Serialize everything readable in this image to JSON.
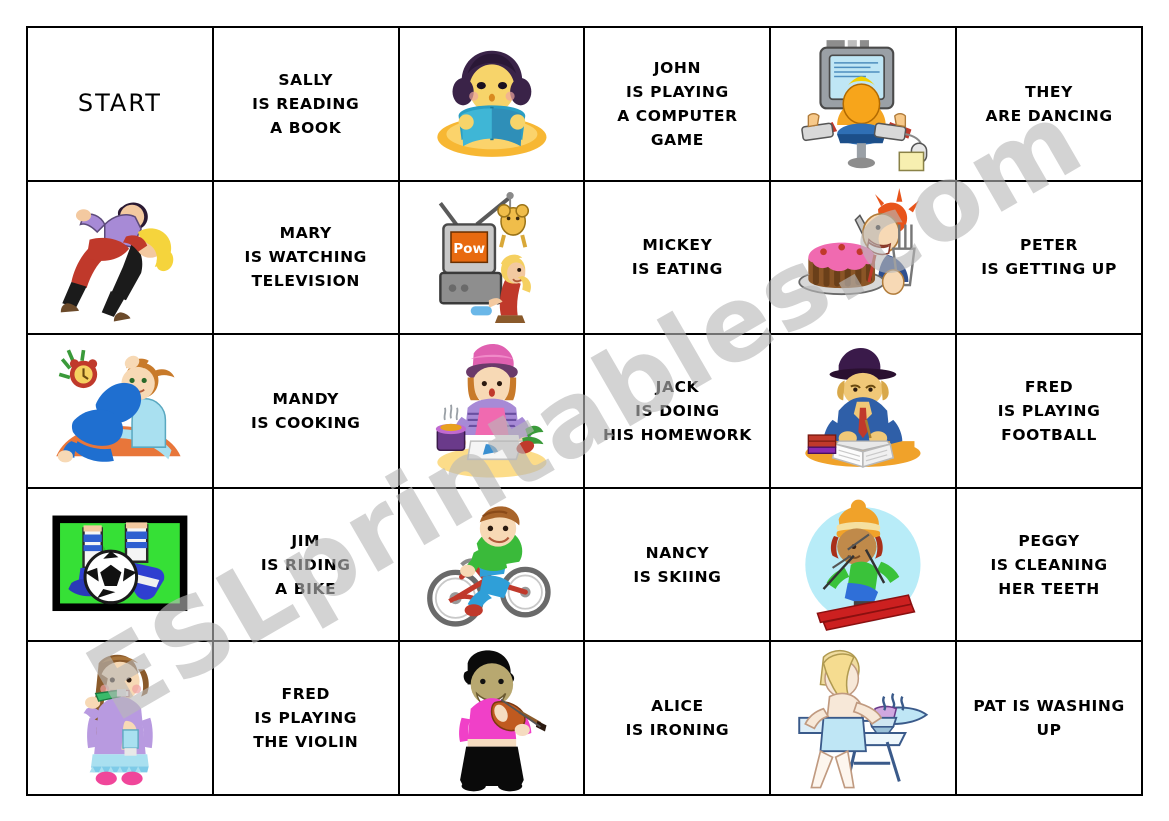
{
  "sheet": {
    "watermark": "ESLprintables.com",
    "columns": 6,
    "rows": 5,
    "border_color": "#000000",
    "background": "#ffffff"
  },
  "cells": [
    {
      "id": "r1c1",
      "type": "text",
      "text": "START",
      "style": "start"
    },
    {
      "id": "r1c2",
      "type": "text",
      "text": "SALLY\nIS READING\nA BOOK"
    },
    {
      "id": "r1c3",
      "type": "image",
      "art": "girl-reading-book",
      "alt": "girl reading a book"
    },
    {
      "id": "r1c4",
      "type": "text",
      "text": "JOHN\nIS PLAYING\nA COMPUTER\nGAME"
    },
    {
      "id": "r1c5",
      "type": "image",
      "art": "boy-computer-game",
      "alt": "boy playing a computer game"
    },
    {
      "id": "r1c6",
      "type": "text",
      "text": "THEY\nARE DANCING"
    },
    {
      "id": "r2c1",
      "type": "image",
      "art": "couple-dancing",
      "alt": "couple dancing"
    },
    {
      "id": "r2c2",
      "type": "text",
      "text": "MARY\nIS WATCHING\nTELEVISION"
    },
    {
      "id": "r2c3",
      "type": "image",
      "art": "girl-watching-tv",
      "alt": "girl watching television"
    },
    {
      "id": "r2c4",
      "type": "text",
      "text": "MICKEY\nIS EATING"
    },
    {
      "id": "r2c5",
      "type": "image",
      "art": "man-eating-cake",
      "alt": "man eating cake"
    },
    {
      "id": "r2c6",
      "type": "text",
      "text": "PETER\nIS GETTING UP"
    },
    {
      "id": "r3c1",
      "type": "image",
      "art": "boy-getting-up",
      "alt": "boy getting up with alarm clock"
    },
    {
      "id": "r3c2",
      "type": "text",
      "text": "MANDY\nIS COOKING"
    },
    {
      "id": "r3c3",
      "type": "image",
      "art": "girl-cooking",
      "alt": "girl cooking"
    },
    {
      "id": "r3c4",
      "type": "text",
      "text": "JACK\nIS DOING\nHIS HOMEWORK"
    },
    {
      "id": "r3c5",
      "type": "image",
      "art": "boy-homework",
      "alt": "boy doing homework"
    },
    {
      "id": "r3c6",
      "type": "text",
      "text": "FRED\nIS PLAYING\nFOOTBALL"
    },
    {
      "id": "r4c1",
      "type": "image",
      "art": "football-kick",
      "alt": "playing football"
    },
    {
      "id": "r4c2",
      "type": "text",
      "text": "JIM\nIS RIDING\nA BIKE"
    },
    {
      "id": "r4c3",
      "type": "image",
      "art": "boy-riding-bike",
      "alt": "boy riding a bike"
    },
    {
      "id": "r4c4",
      "type": "text",
      "text": "NANCY\nIS SKIING"
    },
    {
      "id": "r4c5",
      "type": "image",
      "art": "child-skiing",
      "alt": "child skiing"
    },
    {
      "id": "r4c6",
      "type": "text",
      "text": "PEGGY\nIS CLEANING\nHER TEETH"
    },
    {
      "id": "r5c1",
      "type": "image",
      "art": "girl-brushing-teeth",
      "alt": "girl cleaning her teeth"
    },
    {
      "id": "r5c2",
      "type": "text",
      "text": "FRED\nIS PLAYING\nTHE VIOLIN"
    },
    {
      "id": "r5c3",
      "type": "image",
      "art": "person-violin",
      "alt": "person playing the violin"
    },
    {
      "id": "r5c4",
      "type": "text",
      "text": "ALICE\nIS IRONING"
    },
    {
      "id": "r5c5",
      "type": "image",
      "art": "woman-ironing",
      "alt": "woman ironing"
    },
    {
      "id": "r5c6",
      "type": "text",
      "text": "PAT IS WASHING\nUP"
    }
  ],
  "palette": {
    "skin": "#f3c9a0",
    "skin_dark": "#c79a6a",
    "hair_dark": "#2b1a33",
    "hair_brown": "#8a5a2b",
    "hair_blonde": "#f5d43c",
    "hair_red": "#e8541a",
    "purple": "#a78ad6",
    "red": "#c0392b",
    "blue": "#1f6fd0",
    "light_blue": "#a9e0f0",
    "green": "#2fc52f",
    "bright_green": "#36e036",
    "orange": "#f0a22a",
    "pink": "#f06ab0",
    "grey": "#9aa0a6",
    "black": "#111111",
    "cake_brown": "#8a5526",
    "ski_red": "#cc2020"
  }
}
